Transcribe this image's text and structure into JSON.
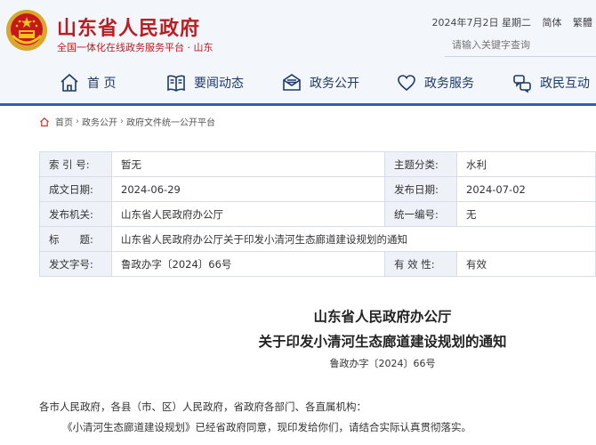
{
  "header": {
    "title": "山东省人民政府",
    "subtitle": "全国一体化在线政务服务平台 · 山东",
    "date": "2024年7月2日 星期二",
    "lang_simplified": "简体",
    "lang_traditional": "繁體",
    "search_placeholder": "请输入关键字查询"
  },
  "nav": {
    "items": [
      {
        "label": "首 页",
        "icon": "home-icon"
      },
      {
        "label": "要闻动态",
        "icon": "news-icon"
      },
      {
        "label": "政务公开",
        "icon": "envelope-icon"
      },
      {
        "label": "政务服务",
        "icon": "heart-icon"
      },
      {
        "label": "政民互动",
        "icon": "interaction-icon"
      }
    ]
  },
  "breadcrumb": [
    "首页",
    "政务公开",
    "政府文件统一公开平台"
  ],
  "meta": {
    "index_no_label": "索 引 号:",
    "index_no": "暂无",
    "category_label": "主题分类:",
    "category": "水利",
    "created_label": "成文日期:",
    "created": "2024-06-29",
    "published_label": "发布日期:",
    "published": "2024-07-02",
    "issuer_label": "发布机关:",
    "issuer": "山东省人民政府办公厅",
    "unified_no_label": "统一编号:",
    "unified_no": "无",
    "title_label": "标　　题:",
    "title": "山东省人民政府办公厅关于印发小清河生态廊道建设规划的通知",
    "doc_no_label": "发文字号:",
    "doc_no": "鲁政办字〔2024〕66号",
    "validity_label": "有 效 性:",
    "validity": "有效"
  },
  "document": {
    "title_line1": "山东省人民政府办公厅",
    "title_line2": "关于印发小清河生态廊道建设规划的通知",
    "number": "鲁政办字〔2024〕66号",
    "para1": "各市人民政府，各县（市、区）人民政府，省政府各部门、各直属机构：",
    "para2": "《小清河生态廊道建设规划》已经省政府同意，现印发给你们，请结合实际认真贯彻落实。"
  },
  "colors": {
    "brand_red": "#b81f24",
    "nav_blue": "#1f3a68",
    "accent_blue": "#2c63ae",
    "valid_red": "#d0311f"
  }
}
